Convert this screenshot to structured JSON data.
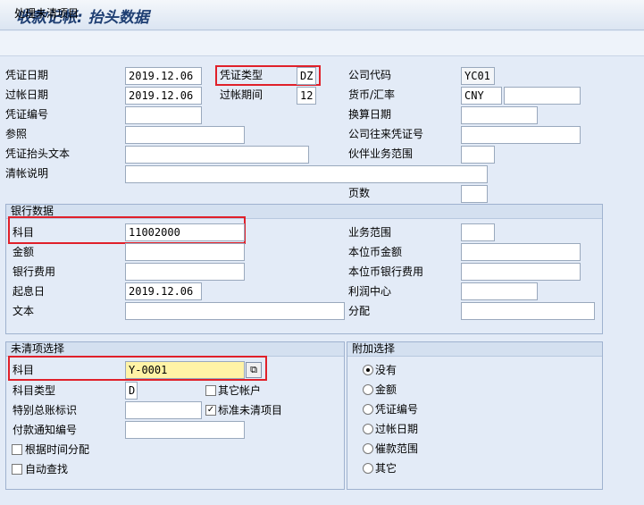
{
  "title": "收款记帐: 抬头数据",
  "toolbar": {
    "open_items_label": "处理未清项目"
  },
  "header": {
    "doc_date_label": "凭证日期",
    "doc_date": "2019.12.06",
    "doc_type_label": "凭证类型",
    "doc_type": "DZ",
    "company_code_label": "公司代码",
    "company_code": "YC01",
    "posting_date_label": "过帐日期",
    "posting_date": "2019.12.06",
    "period_label": "过帐期间",
    "period": "12",
    "currency_label": "货币/汇率",
    "currency": "CNY",
    "rate": "",
    "doc_number_label": "凭证编号",
    "doc_number": "",
    "translation_date_label": "换算日期",
    "translation_date": "",
    "reference_label": "参照",
    "reference": "",
    "intercompany_label": "公司往来凭证号",
    "intercompany": "",
    "header_text_label": "凭证抬头文本",
    "header_text": "",
    "trading_partner_label": "伙伴业务范围",
    "trading_partner": "",
    "clearing_text_label": "清帐说明",
    "clearing_text": "",
    "page_label": "页数",
    "page": ""
  },
  "bank": {
    "group_label": "银行数据",
    "account_label": "科目",
    "account": "11002000",
    "business_area_label": "业务范围",
    "business_area": "",
    "amount_label": "金额",
    "amount": "",
    "local_amount_label": "本位币金额",
    "local_amount": "",
    "bank_charges_label": "银行费用",
    "bank_charges": "",
    "local_charges_label": "本位币银行费用",
    "local_charges": "",
    "value_date_label": "起息日",
    "value_date": "2019.12.06",
    "profit_center_label": "利润中心",
    "profit_center": "",
    "text_label": "文本",
    "text": "",
    "assignment_label": "分配",
    "assignment": ""
  },
  "open_items": {
    "group_label": "未清项选择",
    "account_label": "科目",
    "account": "Y-0001",
    "account_type_label": "科目类型",
    "account_type": "D",
    "other_accounts_label": "其它帐户",
    "special_gl_label": "特别总账标识",
    "special_gl": "",
    "standard_oi_label": "标准未清项目",
    "payment_advice_label": "付款通知编号",
    "payment_advice": "",
    "distribute_by_age_label": "根据时间分配",
    "auto_search_label": "自动查找"
  },
  "additional": {
    "group_label": "附加选择",
    "options": [
      "没有",
      "金额",
      "凭证编号",
      "过帐日期",
      "催款范围",
      "其它"
    ],
    "selected": "没有"
  }
}
